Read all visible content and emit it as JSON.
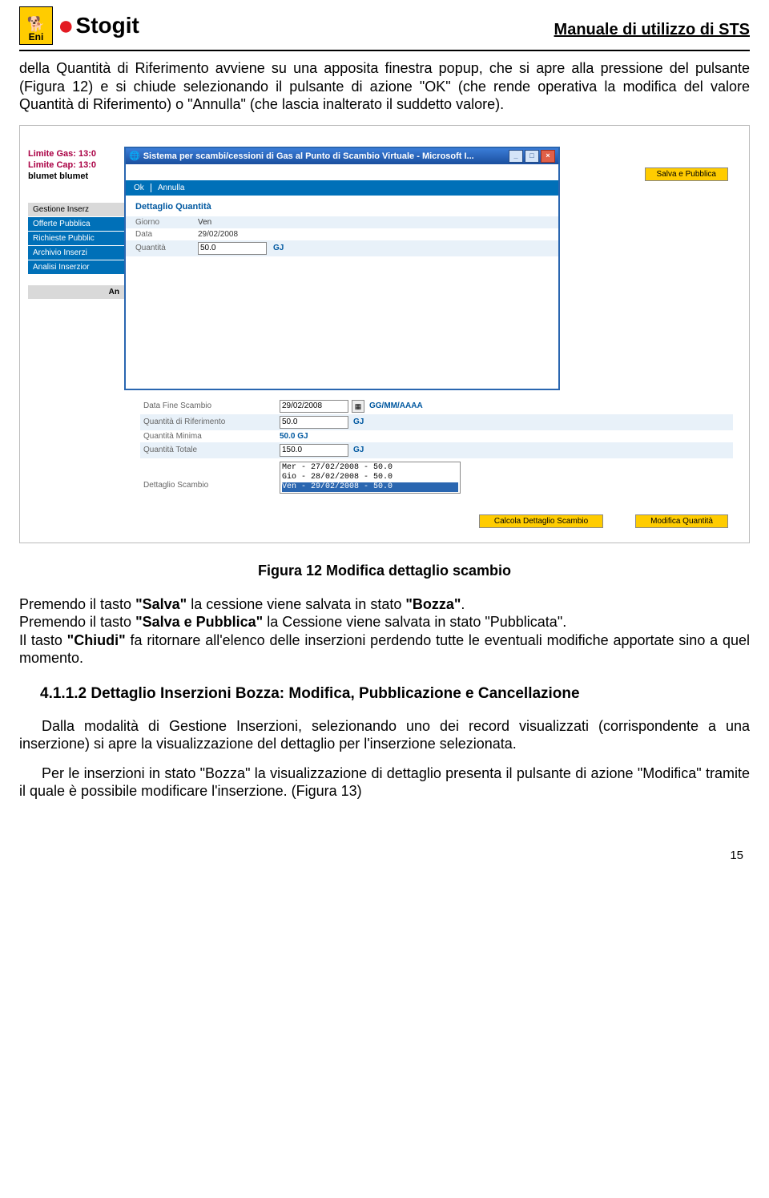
{
  "header": {
    "brand_eni": "Eni",
    "brand_stogit": "Stogit",
    "title": "Manuale di utilizzo di STS"
  },
  "para1": "della Quantità di Riferimento avviene su una apposita finestra popup, che si apre alla pressione del pulsante (Figura 12) e si chiude selezionando il pulsante di azione \"OK\" (che rende operativa la modifica del valore Quantità di Riferimento) o \"Annulla\" (che lascia inalterato il suddetto valore).",
  "app": {
    "limit_gas": "Limite Gas: 13:0",
    "limit_cap": "Limite Cap: 13:0",
    "blumet": "blumet blumet",
    "btn_salva_pubblica": "Salva e Pubblica",
    "sidebar": {
      "header": "Gestione Inserz",
      "items": [
        "Offerte Pubblica",
        "Richieste Pubblic",
        "Archivio Inserzi",
        "Analisi Inserzior"
      ],
      "footer": "An"
    },
    "popup": {
      "title": "Sistema per scambi/cessioni di Gas al Punto di Scambio Virtuale - Microsoft I...",
      "ok": "Ok",
      "annulla": "Annulla",
      "section_title": "Dettaglio Quantità",
      "rows": {
        "giorno_label": "Giorno",
        "giorno_value": "Ven",
        "data_label": "Data",
        "data_value": "29/02/2008",
        "quantita_label": "Quantità",
        "quantita_value": "50.0",
        "quantita_unit": "GJ"
      }
    },
    "main": {
      "data_fine_label": "Data Fine Scambio",
      "data_fine_value": "29/02/2008",
      "data_fine_hint": "GG/MM/AAAA",
      "qta_rif_label": "Quantità di Riferimento",
      "qta_rif_value": "50.0",
      "qta_rif_unit": "GJ",
      "qta_min_label": "Quantità Minima",
      "qta_min_value": "50.0 GJ",
      "qta_tot_label": "Quantità Totale",
      "qta_tot_value": "150.0",
      "qta_tot_unit": "GJ",
      "dettaglio_label": "Dettaglio Scambio",
      "list": {
        "r1": "Mer - 27/02/2008 - 50.0",
        "r2": "Gio - 28/02/2008 - 50.0",
        "r3": "Ven - 29/02/2008 - 50.0"
      },
      "btn_calcola": "Calcola Dettaglio Scambio",
      "btn_modifica": "Modifica Quantità"
    }
  },
  "caption": "Figura 12 Modifica dettaglio scambio",
  "para2a": "Premendo il tasto ",
  "para2_salva": "\"Salva\"",
  "para2b": " la cessione viene salvata in stato ",
  "para2_bozza": "\"Bozza\"",
  "para2c": ".",
  "para3a": "Premendo il tasto ",
  "para3_sp": "\"Salva e Pubblica\"",
  "para3b": " la Cessione viene salvata in stato \"Pubblicata\".",
  "para4a": "Il tasto ",
  "para4_chiudi": "\"Chiudi\"",
  "para4b": " fa ritornare all'elenco delle inserzioni perdendo tutte le eventuali modifiche apportate sino a quel momento.",
  "section412": "4.1.1.2  Dettaglio Inserzioni Bozza: Modifica, Pubblicazione e Cancellazione",
  "para5": "Dalla modalità di Gestione Inserzioni, selezionando uno dei record visualizzati (corrispondente a una inserzione) si apre la visualizzazione del dettaglio per l'inserzione selezionata.",
  "para6": "Per le inserzioni in stato \"Bozza\" la visualizzazione di dettaglio presenta il pulsante di azione \"Modifica\" tramite il quale è possibile modificare l'inserzione. (Figura 13)",
  "page_number": "15"
}
